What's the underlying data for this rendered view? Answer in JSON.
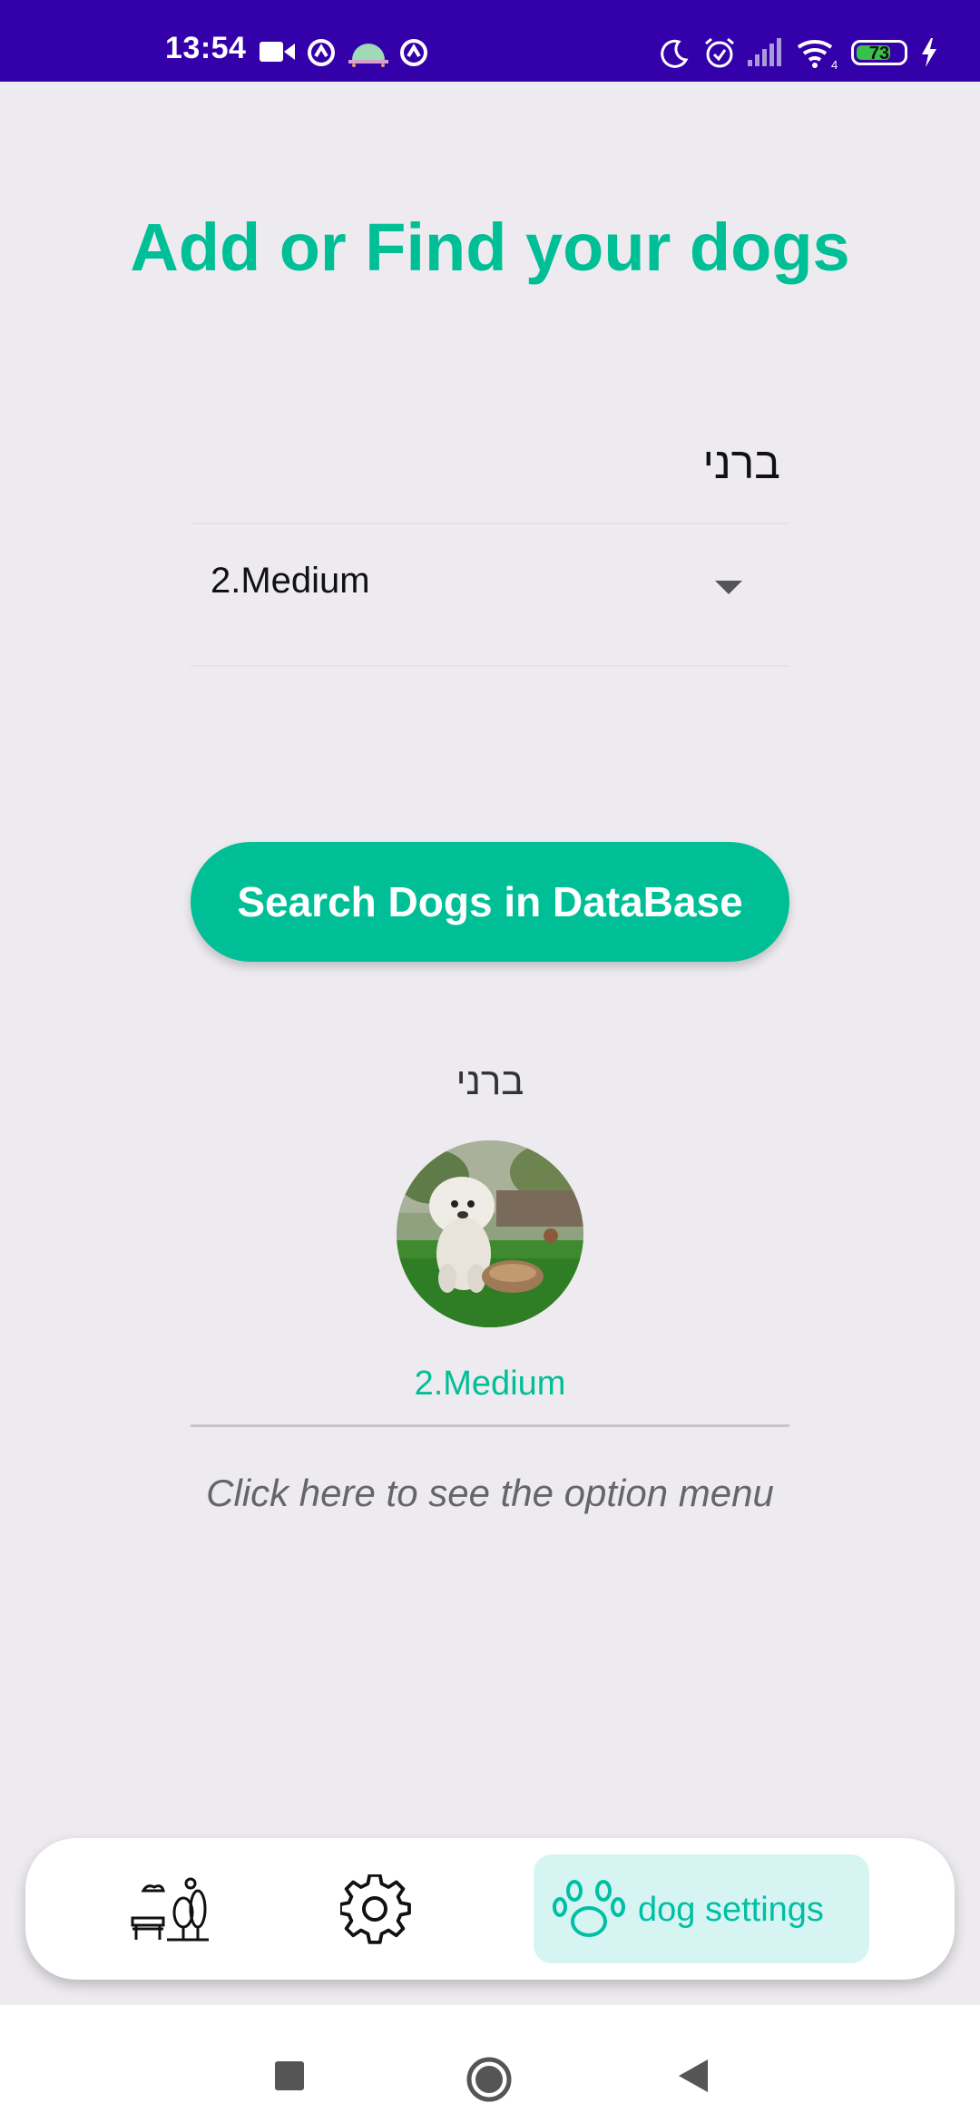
{
  "status_bar": {
    "time": "13:54",
    "battery_level": "73",
    "icons": [
      "video-camera-icon",
      "app-notification-icon",
      "android-icon",
      "app-notification-icon",
      "do-not-disturb-moon-icon",
      "alarm-icon",
      "signal-icon",
      "wifi-icon",
      "battery-icon",
      "charging-bolt-icon"
    ]
  },
  "main": {
    "title": "Add or Find your dogs",
    "name_input": {
      "value": "ברני"
    },
    "size_select": {
      "selected": "2.Medium"
    },
    "search_button": "Search Dogs in DataBase",
    "result": {
      "name": "ברני",
      "size": "2.Medium",
      "hint": "Click here to see the option menu"
    }
  },
  "bottom_nav": {
    "items": [
      {
        "icon": "park-bench-icon"
      },
      {
        "icon": "gear-icon"
      },
      {
        "icon": "paw-icon",
        "label": "dog settings",
        "active": true
      }
    ]
  },
  "colors": {
    "accent": "#00bf96",
    "status_bar": "#3300aa",
    "background": "#edebef",
    "active_tab_bg": "#d6f5f2"
  }
}
